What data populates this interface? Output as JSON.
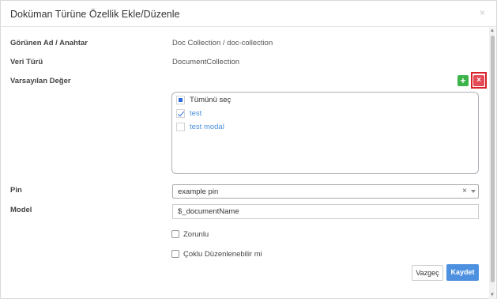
{
  "modal": {
    "title": "Doküman Türüne Özellik Ekle/Düzenle",
    "close_label": "×"
  },
  "fields": {
    "display_name": {
      "label": "Görünen Ad / Anahtar",
      "value": "Doc Collection / doc-collection"
    },
    "data_type": {
      "label": "Veri Türü",
      "value": "DocumentCollection"
    },
    "default_value": {
      "label": "Varsayılan Değer",
      "add_label": "+",
      "remove_label": "×",
      "options": [
        {
          "text": "Tümünü seç",
          "state": "partial"
        },
        {
          "text": "test",
          "state": "checked"
        },
        {
          "text": "test modal",
          "state": "unchecked"
        }
      ]
    },
    "pin": {
      "label": "Pin",
      "selected": "example pin",
      "clear_label": "×"
    },
    "model": {
      "label": "Model",
      "value": "$_documentName"
    },
    "required": {
      "label": "Zorunlu",
      "checked": false
    },
    "multi_editable": {
      "label": "Çoklu Düzenlenebilir mi",
      "checked": false
    }
  },
  "footer": {
    "cancel_label": "Vazgeç",
    "save_label": "Kaydet"
  },
  "colors": {
    "primary": "#4d90e0",
    "success": "#3cb44b",
    "danger": "#e34b57",
    "highlight_frame": "#d8232a",
    "link": "#4a90d9"
  }
}
